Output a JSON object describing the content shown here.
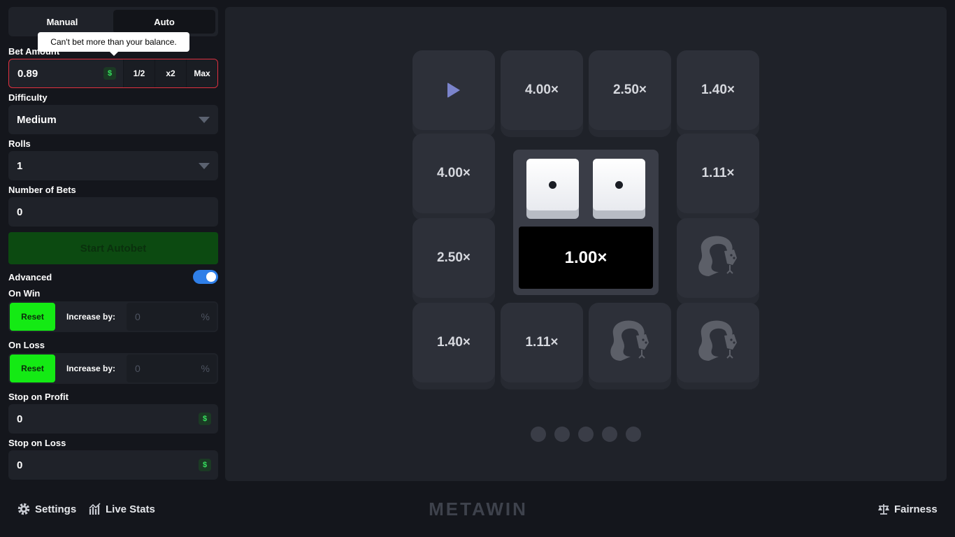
{
  "mode_tabs": {
    "manual": "Manual",
    "auto": "Auto"
  },
  "tooltip": "Can't bet more than your balance.",
  "bet": {
    "label": "Bet Amount",
    "value": "0.89",
    "currency": "$",
    "half": "1/2",
    "double": "x2",
    "max": "Max"
  },
  "difficulty": {
    "label": "Difficulty",
    "value": "Medium"
  },
  "rolls": {
    "label": "Rolls",
    "value": "1"
  },
  "num_bets": {
    "label": "Number of Bets",
    "value": "0"
  },
  "start_button": "Start Autobet",
  "advanced": {
    "label": "Advanced",
    "enabled": true
  },
  "on_win": {
    "label": "On Win",
    "reset": "Reset",
    "increase": "Increase by:",
    "value": "0",
    "unit": "%"
  },
  "on_loss": {
    "label": "On Loss",
    "reset": "Reset",
    "increase": "Increase by:",
    "value": "0",
    "unit": "%"
  },
  "stop_profit": {
    "label": "Stop on Profit",
    "value": "0",
    "currency": "$"
  },
  "stop_loss": {
    "label": "Stop on Loss",
    "value": "0",
    "currency": "$"
  },
  "board": {
    "tiles": [
      "4.00×",
      "2.50×",
      "1.40×",
      "4.00×",
      "1.11×",
      "2.50×",
      "1.40×",
      "1.11×"
    ],
    "result": "1.00×",
    "dice": [
      1,
      1
    ]
  },
  "footer": {
    "settings": "Settings",
    "live_stats": "Live Stats",
    "logo": "METAWIN",
    "fairness": "Fairness"
  }
}
